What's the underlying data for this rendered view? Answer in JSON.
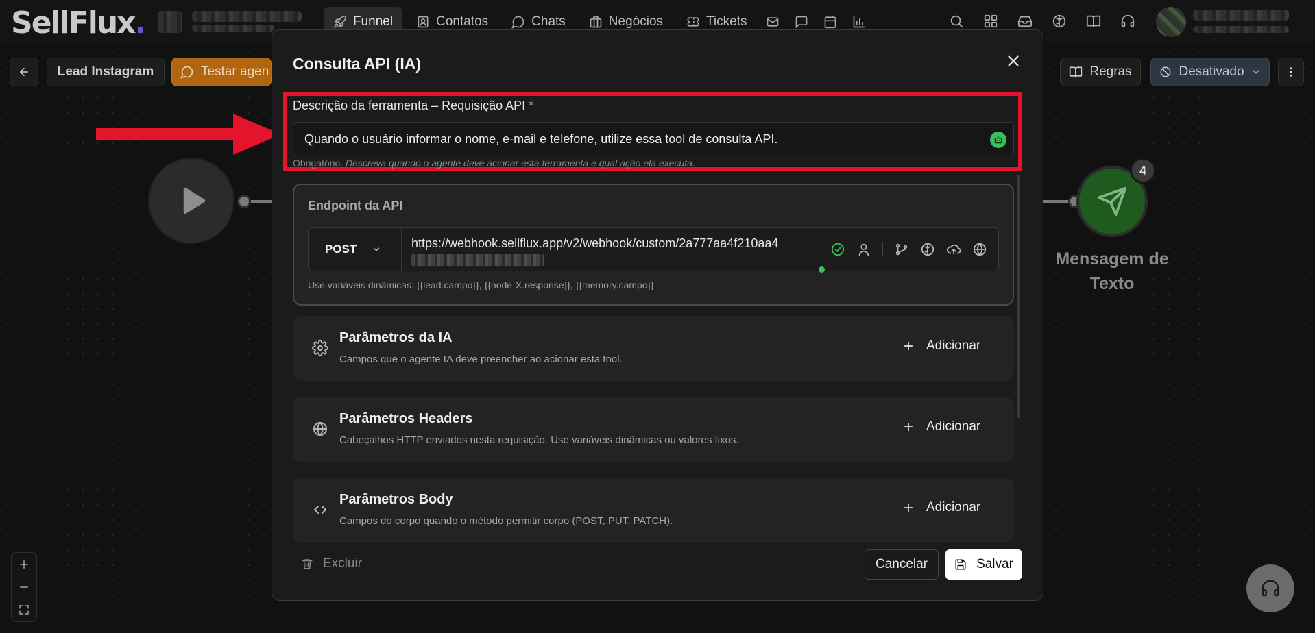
{
  "app": {
    "logo_text": "SellFlux",
    "logo_dot": "."
  },
  "nav": {
    "tabs": [
      {
        "label": "Funnel",
        "icon": "rocket-icon",
        "active": true
      },
      {
        "label": "Contatos",
        "icon": "contacts-icon"
      },
      {
        "label": "Chats",
        "icon": "chat-bubble-icon"
      },
      {
        "label": "Negócios",
        "icon": "briefcase-icon"
      },
      {
        "label": "Tickets",
        "icon": "ticket-icon"
      }
    ],
    "icon_tabs": [
      "mail-icon",
      "message-square-icon",
      "calendar-icon",
      "bar-chart-icon"
    ],
    "right_icons": [
      "search-icon",
      "grid-icon",
      "inbox-icon",
      "brain-icon",
      "book-icon",
      "headset-icon"
    ]
  },
  "toolbar": {
    "back_icon": "arrow-left-icon",
    "funnel_name": "Lead Instagram",
    "test_agent_label": "Testar agen",
    "rules_label": "Regras",
    "status_label": "Desativado",
    "more_icon": "more-vertical-icon"
  },
  "flow": {
    "start_icon": "play-icon",
    "send_node_badge": "4",
    "send_node_label": "Mensagem de Texto"
  },
  "modal": {
    "title": "Consulta API (IA)",
    "description": {
      "label": "Descrição da ferramenta – Requisição API",
      "required_mark": "*",
      "value": "Quando o usuário informar o nome, e-mail e telefone, utilize essa tool de consulta API.",
      "hint_prefix": "Obrigatório.",
      "hint_text": "Descreva quando o agente deve acionar esta ferramenta e qual ação ela executa."
    },
    "endpoint": {
      "title": "Endpoint da API",
      "method": "POST",
      "url": "https://webhook.sellflux.app/v2/webhook/custom/2a777aa4f210aa4",
      "help": "Use variáveis dinâmicas: {{lead.campo}}, {{node-X.response}}, {{memory.campo}}"
    },
    "params": [
      {
        "title": "Parâmetros da IA",
        "desc": "Campos que o agente IA deve preencher ao acionar esta tool.",
        "add_label": "Adicionar",
        "icon": "gear-icon"
      },
      {
        "title": "Parâmetros Headers",
        "desc": "Cabeçalhos HTTP enviados nesta requisição. Use variáveis dinâmicas ou valores fixos.",
        "add_label": "Adicionar",
        "icon": "globe-icon"
      },
      {
        "title": "Parâmetros Body",
        "desc": "Campos do corpo quando o método permitir corpo (POST, PUT, PATCH).",
        "add_label": "Adicionar",
        "icon": "code-icon"
      }
    ],
    "footer": {
      "delete_label": "Excluir",
      "cancel_label": "Cancelar",
      "save_label": "Salvar"
    }
  },
  "colors": {
    "highlight_frame": "#e3142b",
    "accent_green": "#3cbf5a",
    "test_agent_orange": "#b26510"
  }
}
